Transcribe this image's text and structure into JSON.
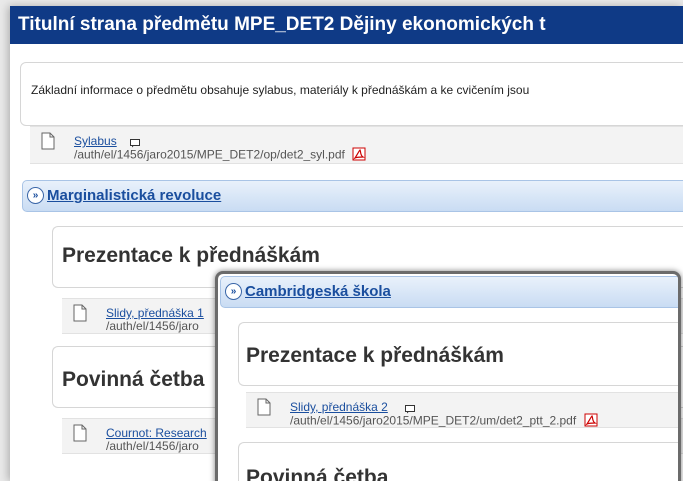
{
  "window": {
    "title": "Titulní strana předmětu MPE_DET2 Dějiny ekonomických t"
  },
  "intro": {
    "text": "Základní informace o předmětu obsahuje sylabus, materiály k přednáškám a ke cvičením jsou"
  },
  "syllabus": {
    "link": "Sylabus",
    "path": "/auth/el/1456/jaro2015/MPE_DET2/op/det2_syl.pdf"
  },
  "section1": {
    "title": "Marginalistická revoluce",
    "heading_presentations": "Prezentace k přednáškám",
    "file1": {
      "link": "Slidy, přednáška 1",
      "path": "/auth/el/1456/jaro"
    },
    "heading_reading": "Povinná četba",
    "file2": {
      "link": "Cournot: Research",
      "path": "/auth/el/1456/jaro"
    }
  },
  "overlay": {
    "title": "Cambridgeská škola",
    "heading_presentations": "Prezentace k přednáškám",
    "file1": {
      "link": "Slidy, přednáška 2",
      "path": "/auth/el/1456/jaro2015/MPE_DET2/um/det2_ptt_2.pdf"
    },
    "heading_reading": "Povinná četba"
  },
  "colors": {
    "titlebar": "#0f3a86",
    "link": "#1a4e9e",
    "section_header": "#c9dcf3"
  },
  "icons": [
    "document-icon",
    "comment-icon",
    "pdf-icon",
    "expand-chevron-icon"
  ]
}
